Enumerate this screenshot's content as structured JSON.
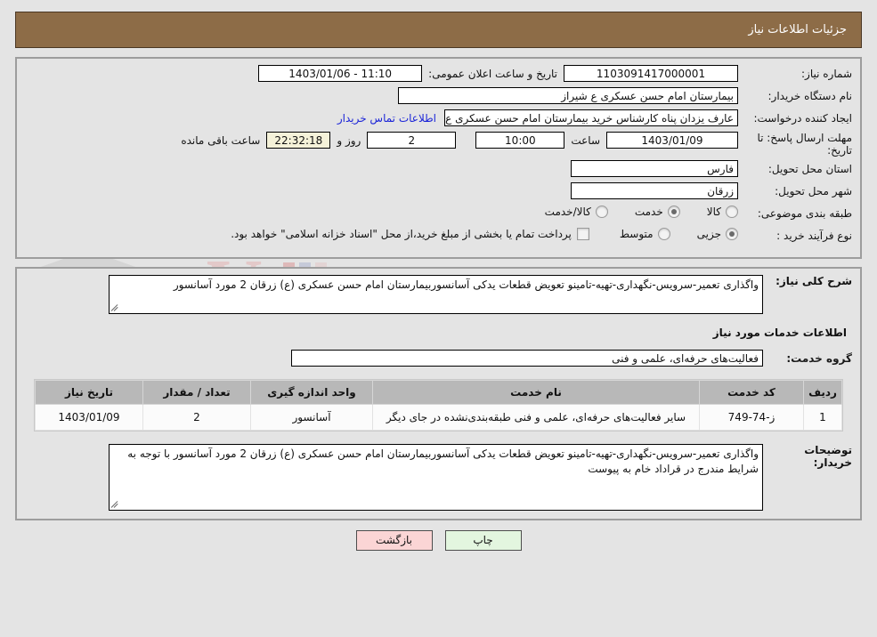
{
  "header": {
    "title": "جزئیات اطلاعات نیاز"
  },
  "watermark": {
    "brand": "AriaTender.net",
    "mark": "V"
  },
  "form": {
    "need_number": {
      "label": "شماره نیاز:",
      "value": "1103091417000001"
    },
    "public_announce": {
      "label": "تاریخ و ساعت اعلان عمومی:",
      "value": "11:10 - 1403/01/06"
    },
    "buyer_org": {
      "label": "نام دستگاه خریدار:",
      "value": "بیمارستان امام حسن عسکری  ع  شیراز"
    },
    "creator": {
      "label": "ایجاد کننده درخواست:",
      "value": "عارف یزدان پناه کارشناس خرید  بیمارستان امام حسن عسکری  ع  شیراز"
    },
    "contact_link": "اطلاعات تماس خریدار",
    "deadline": {
      "label": "مهلت ارسال پاسخ: تا تاریخ:",
      "date": "1403/01/09",
      "time_label": "ساعت",
      "time": "10:00",
      "days": "2",
      "days_label": "روز و",
      "countdown": "22:32:18",
      "countdown_label": "ساعت باقی مانده"
    },
    "province": {
      "label": "استان محل تحویل:",
      "value": "فارس"
    },
    "city": {
      "label": "شهر محل تحویل:",
      "value": "زرقان"
    },
    "category": {
      "label": "طبقه بندی موضوعی:",
      "options": [
        {
          "label": "کالا",
          "selected": false
        },
        {
          "label": "خدمت",
          "selected": true
        },
        {
          "label": "کالا/خدمت",
          "selected": false
        }
      ]
    },
    "purchase_type": {
      "label": "نوع فرآیند خرید :",
      "options": [
        {
          "label": "جزیی",
          "selected": true
        },
        {
          "label": "متوسط",
          "selected": false
        }
      ],
      "checkbox_text": "پرداخت تمام یا بخشی از مبلغ خرید،از محل \"اسناد خزانه اسلامی\" خواهد بود.",
      "checkbox_checked": false
    }
  },
  "need_summary": {
    "label": "شرح کلی نیاز:",
    "value": "واگذاری تعمیر-سرویس-نگهداری-تهیه-تامینو تعویض قطعات یدکی آسانسوربیمارستان امام حسن عسکری (ع) زرقان 2 مورد آسانسور"
  },
  "services_section": {
    "heading": "اطلاعات خدمات مورد نیاز",
    "group": {
      "label": "گروه خدمت:",
      "value": "فعالیت‌های حرفه‌ای، علمی و فنی"
    }
  },
  "table": {
    "columns": [
      "ردیف",
      "کد خدمت",
      "نام خدمت",
      "واحد اندازه گیری",
      "تعداد / مقدار",
      "تاریخ نیاز"
    ],
    "rows": [
      {
        "radif": "1",
        "code": "ز-74-749",
        "name": "سایر فعالیت‌های حرفه‌ای، علمی و فنی طبقه‌بندی‌نشده در جای دیگر",
        "unit": "آسانسور",
        "qty": "2",
        "date": "1403/01/09"
      }
    ]
  },
  "buyer_notes": {
    "label": "توضیحات خریدار:",
    "value": "واگذاری تعمیر-سرویس-نگهداری-تهیه-تامینو تعویض قطعات یدکی آسانسوربیمارستان امام حسن عسکری (ع) زرقان 2 مورد آسانسور  با توجه به شرایط مندرج در  قراداد خام به پیوست"
  },
  "buttons": {
    "print": "چاپ",
    "back": "بازگشت"
  }
}
